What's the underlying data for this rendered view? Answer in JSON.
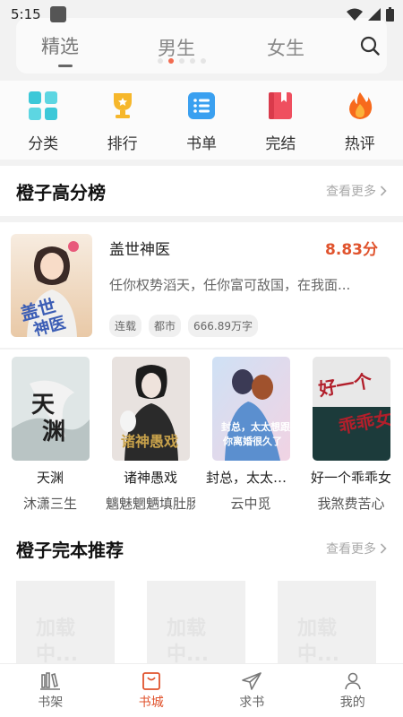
{
  "status": {
    "time": "5:15"
  },
  "tabs": [
    {
      "label": "精选",
      "active": true
    },
    {
      "label": "男生",
      "active": false
    },
    {
      "label": "女生",
      "active": false
    }
  ],
  "categories": [
    {
      "label": "分类",
      "icon": "grid-icon"
    },
    {
      "label": "排行",
      "icon": "trophy-icon"
    },
    {
      "label": "书单",
      "icon": "list-icon"
    },
    {
      "label": "完结",
      "icon": "book-icon"
    },
    {
      "label": "热评",
      "icon": "flame-icon"
    }
  ],
  "high_score": {
    "title": "橙子高分榜",
    "more": "查看更多",
    "featured": {
      "title": "盖世神医",
      "score": "8.83分",
      "desc": "任你权势滔天，任你富可敌国，在我面...",
      "tags": [
        "连载",
        "都市",
        "666.89万字"
      ],
      "cover_text": "盖世神医"
    },
    "books": [
      {
        "title": "天渊",
        "author": "沐潇三生",
        "cover_text": "天渊"
      },
      {
        "title": "诸神愚戏",
        "author": "魑魅魍魉填肚肠",
        "cover_text": "诸神愚戏"
      },
      {
        "title": "封总，太太想...",
        "author": "云中觅",
        "cover_text": "封总，太太想跟你离婚很久了"
      },
      {
        "title": "好一个乖乖女",
        "author": "我煞费苦心",
        "cover_text": "好一个乖乖女"
      }
    ]
  },
  "complete": {
    "title": "橙子完本推荐",
    "more": "查看更多",
    "loading": "加载中..."
  },
  "bottom_nav": [
    {
      "label": "书架",
      "active": false,
      "icon": "bookshelf-icon"
    },
    {
      "label": "书城",
      "active": true,
      "icon": "store-icon"
    },
    {
      "label": "求书",
      "active": false,
      "icon": "send-icon"
    },
    {
      "label": "我的",
      "active": false,
      "icon": "profile-icon"
    }
  ],
  "colors": {
    "accent": "#e0532d",
    "background": "#f2f2f2"
  }
}
